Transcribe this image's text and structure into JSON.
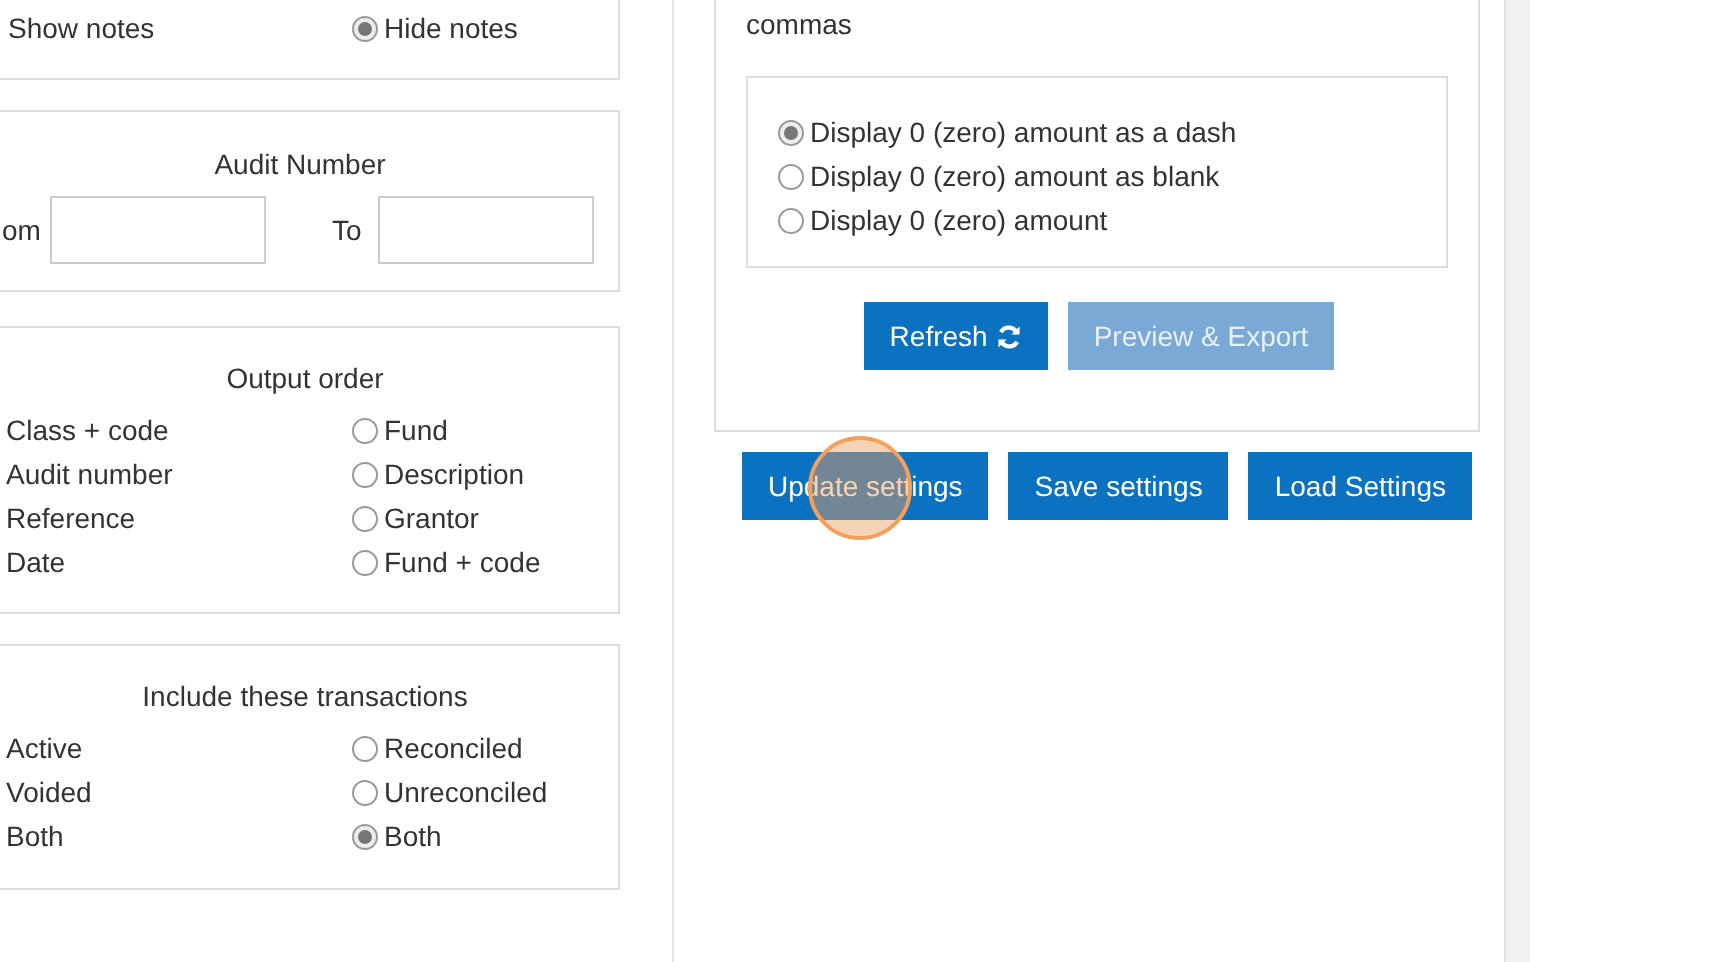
{
  "notes": {
    "left_label": "Show notes",
    "right_options": [
      {
        "label": "Hide notes",
        "selected": true
      }
    ]
  },
  "audit_number": {
    "title": "Audit Number",
    "from_label": "om",
    "to_label": "To"
  },
  "option_groups": [
    {
      "title": "Output order",
      "left_labels": [
        "Class + code",
        "Audit number",
        "Reference",
        "Date"
      ],
      "right_options": [
        {
          "label": "Fund",
          "selected": false
        },
        {
          "label": "Description",
          "selected": false
        },
        {
          "label": "Grantor",
          "selected": false
        },
        {
          "label": "Fund + code",
          "selected": false
        }
      ]
    },
    {
      "title": "Include these transactions",
      "left_labels": [
        "Active",
        "Voided",
        "Both"
      ],
      "right_options": [
        {
          "label": "Reconciled",
          "selected": false
        },
        {
          "label": "Unreconciled",
          "selected": false
        },
        {
          "label": "Both",
          "selected": true
        }
      ]
    }
  ],
  "format": {
    "text": "commas",
    "zero_options": [
      {
        "label": "Display 0 (zero) amount as a dash",
        "selected": true
      },
      {
        "label": "Display 0 (zero) amount as blank",
        "selected": false
      },
      {
        "label": "Display 0 (zero) amount",
        "selected": false
      }
    ],
    "buttons": [
      {
        "label": "Refresh",
        "kind": "refresh",
        "disabled": false
      },
      {
        "label": "Preview & Export",
        "kind": "plain",
        "disabled": true
      }
    ]
  },
  "settings_buttons": [
    {
      "label": "Update settings",
      "clicked": true
    },
    {
      "label": "Save settings",
      "clicked": false
    },
    {
      "label": "Load Settings",
      "clicked": false
    }
  ]
}
